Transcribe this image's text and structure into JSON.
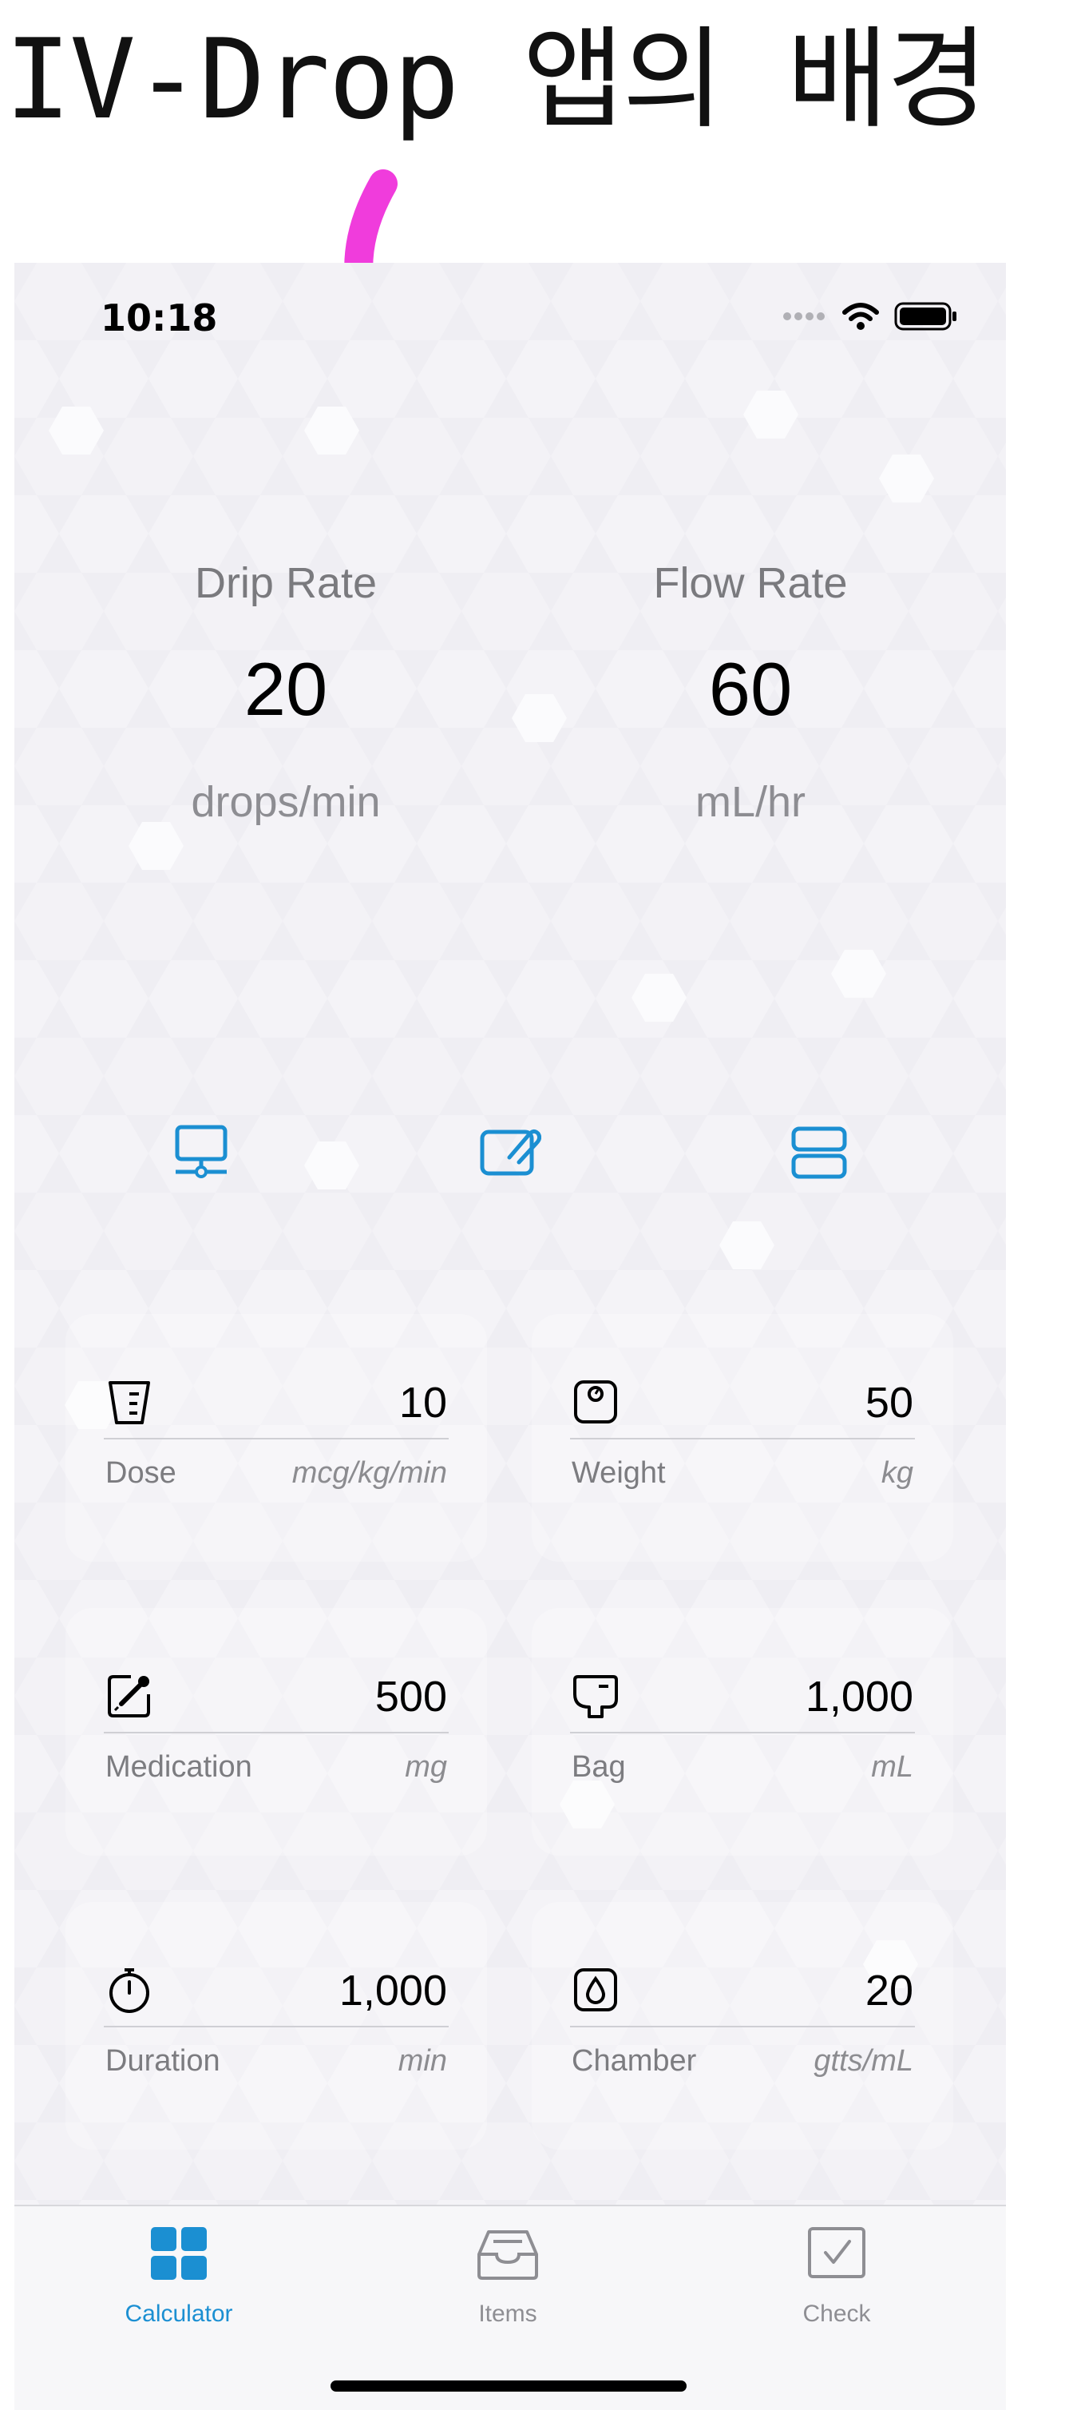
{
  "caption": "IV-Drop 앱의 배경",
  "colors": {
    "accent": "#1b8fd2",
    "arrow": "#f03cdc",
    "background": "#efeef3",
    "inactive_tab": "#8e8e93"
  },
  "status_bar": {
    "time": "10:18",
    "icons": [
      "cellular-dots-icon",
      "wifi-icon",
      "battery-icon"
    ]
  },
  "rates": [
    {
      "label": "Drip Rate",
      "value": "20",
      "unit": "drops/min"
    },
    {
      "label": "Flow Rate",
      "value": "60",
      "unit": "mL/hr"
    }
  ],
  "mode_icons": [
    "monitor-icon",
    "note-attachment-icon",
    "two-rows-icon"
  ],
  "fields": [
    {
      "icon": "cup-icon",
      "name": "Dose",
      "value": "10",
      "unit": "mcg/kg/min"
    },
    {
      "icon": "scale-icon",
      "name": "Weight",
      "value": "50",
      "unit": "kg"
    },
    {
      "icon": "syringe-note-icon",
      "name": "Medication",
      "value": "500",
      "unit": "mg"
    },
    {
      "icon": "iv-bag-icon",
      "name": "Bag",
      "value": "1,000",
      "unit": "mL"
    },
    {
      "icon": "stopwatch-icon",
      "name": "Duration",
      "value": "1,000",
      "unit": "min"
    },
    {
      "icon": "drop-chamber-icon",
      "name": "Chamber",
      "value": "20",
      "unit": "gtts/mL"
    }
  ],
  "tabs": [
    {
      "label": "Calculator",
      "icon": "grid-icon",
      "active": true
    },
    {
      "label": "Items",
      "icon": "tray-icon",
      "active": false
    },
    {
      "label": "Check",
      "icon": "checkbox-icon",
      "active": false
    }
  ]
}
